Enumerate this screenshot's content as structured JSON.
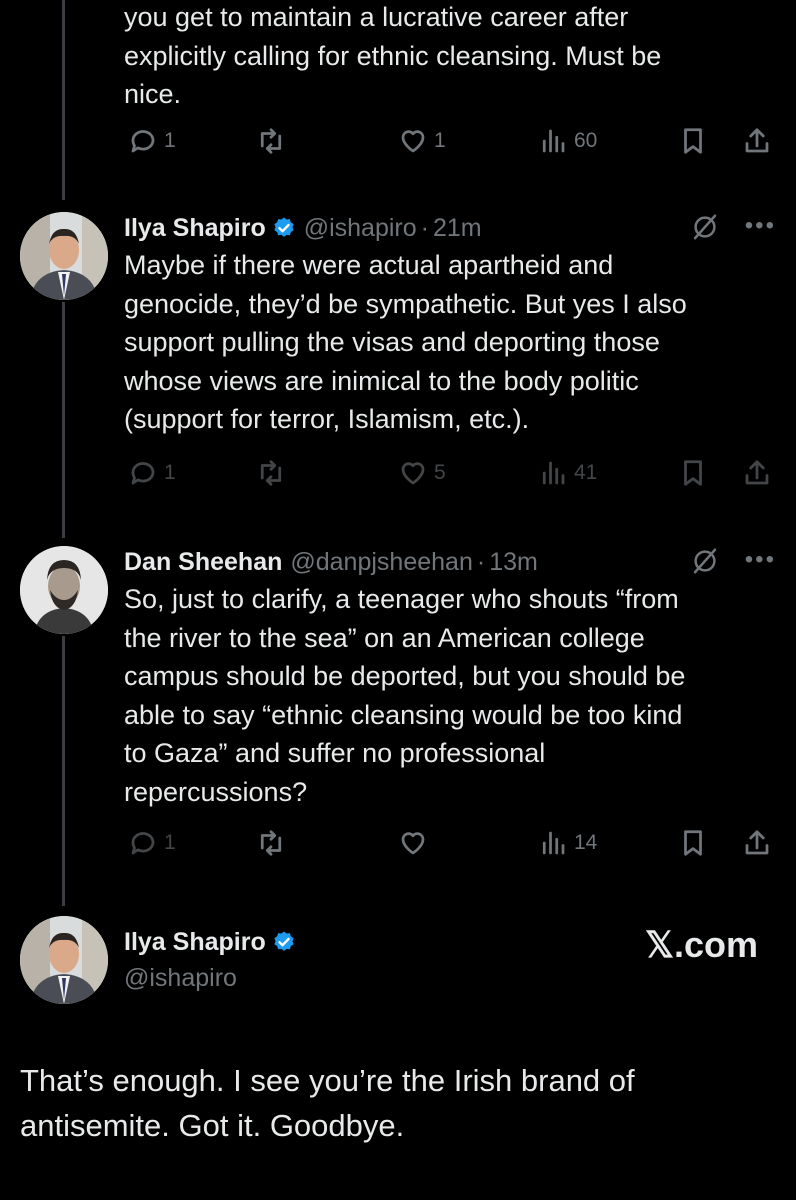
{
  "tweet0": {
    "text_lines": [
      "you get to maintain a lucrative career after",
      "explicitly calling for ethnic cleansing. Must be",
      "nice."
    ],
    "replies": "1",
    "retweets": "",
    "likes": "1",
    "views": "60"
  },
  "tweet1": {
    "name": "Ilya Shapiro",
    "handle": "@ishapiro",
    "time": "21m",
    "text_lines": [
      "Maybe if there were actual apartheid and",
      "genocide, they’d be sympathetic. But yes I also",
      "support pulling the visas and deporting those",
      "whose views are inimical to the body politic",
      "(support for terror, Islamism, etc.)."
    ],
    "replies": "1",
    "retweets": "",
    "likes": "5",
    "views": "41"
  },
  "tweet2": {
    "name": "Dan Sheehan",
    "handle": "@danpjsheehan",
    "time": "13m",
    "text_lines": [
      "So, just to clarify, a teenager who shouts “from",
      "the river to the sea” on an American college",
      "campus should be deported, but you should be",
      "able to say “ethnic cleansing would be too kind",
      "to Gaza” and suffer no professional",
      "repercussions?"
    ],
    "replies": "1",
    "retweets": "",
    "likes": "",
    "views": "14"
  },
  "tweet3": {
    "name": "Ilya Shapiro",
    "handle": "@ishapiro",
    "site": "𝕏.com",
    "text_lines": [
      "That’s enough. I see you’re the Irish brand of",
      "antisemite. Got it. Goodbye."
    ]
  },
  "icons": {
    "reply": "reply-icon",
    "retweet": "retweet-icon",
    "like": "heart-icon",
    "views": "views-icon",
    "bookmark": "bookmark-icon",
    "share": "share-icon",
    "verified": "verified-badge-icon",
    "more": "more-icon",
    "grok": "slash-icon"
  },
  "colors": {
    "background": "#000000",
    "text": "#e7e9ea",
    "muted": "#71767b",
    "verified": "#1d9bf0"
  }
}
